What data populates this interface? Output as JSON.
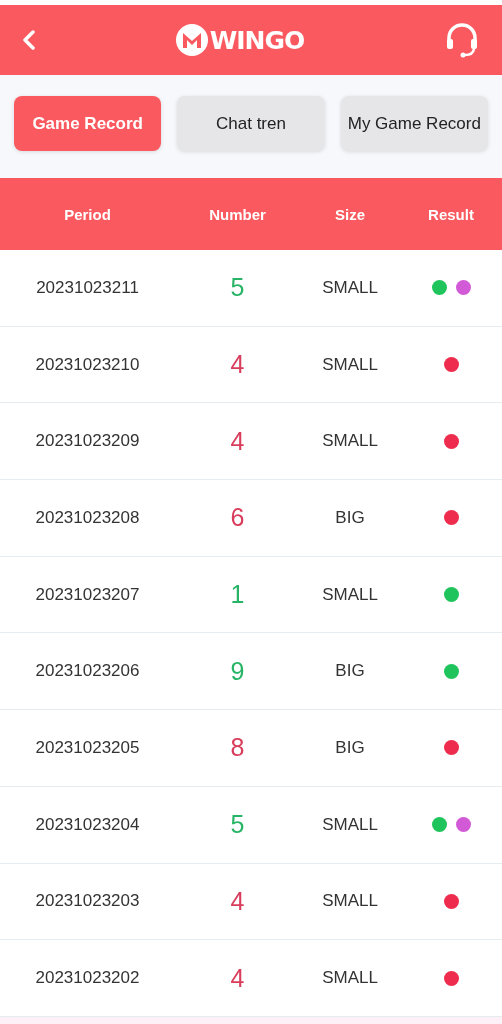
{
  "header": {
    "logo_text": "WINGO"
  },
  "tabs": [
    {
      "label": "Game Record",
      "selected": true
    },
    {
      "label": "Chat tren",
      "selected": false
    },
    {
      "label": "My Game Record",
      "selected": false
    }
  ],
  "table": {
    "columns": [
      "Period",
      "Number",
      "Size",
      "Result"
    ],
    "rows": [
      {
        "period": "20231023211",
        "number": {
          "text": "5",
          "color": "#27b466"
        },
        "size": "SMALL",
        "result": [
          {
            "color": "#20c45c"
          },
          {
            "color": "#d35ad6"
          }
        ]
      },
      {
        "period": "20231023210",
        "number": {
          "text": "4",
          "color": "#d83d5c"
        },
        "size": "SMALL",
        "result": [
          {
            "color": "#ee2c4e"
          }
        ]
      },
      {
        "period": "20231023209",
        "number": {
          "text": "4",
          "color": "#d83d5c"
        },
        "size": "SMALL",
        "result": [
          {
            "color": "#ee2c4e"
          }
        ]
      },
      {
        "period": "20231023208",
        "number": {
          "text": "6",
          "color": "#d83d5c"
        },
        "size": "BIG",
        "result": [
          {
            "color": "#ee2c4e"
          }
        ]
      },
      {
        "period": "20231023207",
        "number": {
          "text": "1",
          "color": "#27b466"
        },
        "size": "SMALL",
        "result": [
          {
            "color": "#20c45c"
          }
        ]
      },
      {
        "period": "20231023206",
        "number": {
          "text": "9",
          "color": "#27b466"
        },
        "size": "BIG",
        "result": [
          {
            "color": "#20c45c"
          }
        ]
      },
      {
        "period": "20231023205",
        "number": {
          "text": "8",
          "color": "#d83d5c"
        },
        "size": "BIG",
        "result": [
          {
            "color": "#ee2c4e"
          }
        ]
      },
      {
        "period": "20231023204",
        "number": {
          "text": "5",
          "color": "#27b466"
        },
        "size": "SMALL",
        "result": [
          {
            "color": "#20c45c"
          },
          {
            "color": "#d35ad6"
          }
        ]
      },
      {
        "period": "20231023203",
        "number": {
          "text": "4",
          "color": "#d83d5c"
        },
        "size": "SMALL",
        "result": [
          {
            "color": "#ee2c4e"
          }
        ]
      },
      {
        "period": "20231023202",
        "number": {
          "text": "4",
          "color": "#d83d5c"
        },
        "size": "SMALL",
        "result": [
          {
            "color": "#ee2c4e"
          }
        ]
      }
    ]
  }
}
